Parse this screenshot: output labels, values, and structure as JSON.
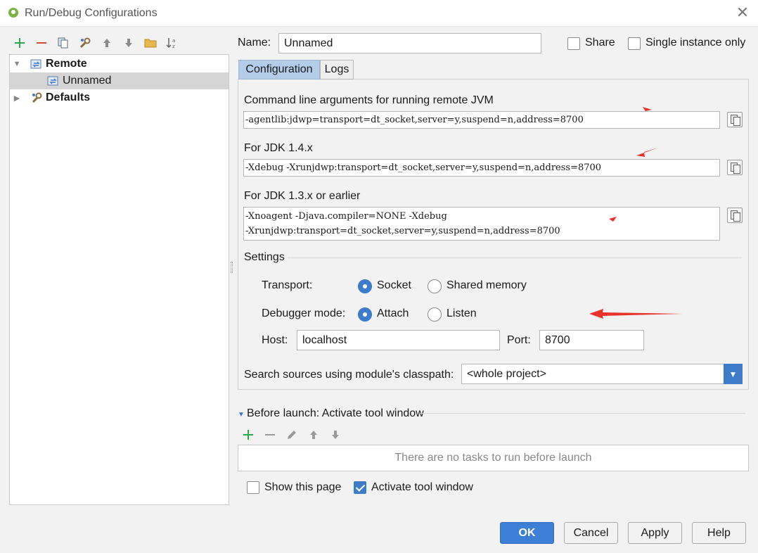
{
  "window": {
    "title": "Run/Debug Configurations"
  },
  "tree": {
    "items": [
      {
        "label": "Remote"
      },
      {
        "label": "Unnamed"
      },
      {
        "label": "Defaults"
      }
    ]
  },
  "form": {
    "name_label": "Name:",
    "name_value": "Unnamed",
    "share_label": "Share",
    "single_instance_label": "Single instance only"
  },
  "tabs": [
    {
      "label": "Configuration"
    },
    {
      "label": "Logs"
    }
  ],
  "config": {
    "jvm_label": "Command line arguments for running remote JVM",
    "jvm_value": "-agentlib:jdwp=transport=dt_socket,server=y,suspend=n,address=8700",
    "jdk14_label": "For JDK 1.4.x",
    "jdk14_value": "-Xdebug -Xrunjdwp:transport=dt_socket,server=y,suspend=n,address=8700",
    "jdk13_label": "For JDK 1.3.x or earlier",
    "jdk13_line1": "-Xnoagent -Djava.compiler=NONE -Xdebug",
    "jdk13_line2": "-Xrunjdwp:transport=dt_socket,server=y,suspend=n,address=8700",
    "settings_label": "Settings",
    "transport_label": "Transport:",
    "transport_socket": "Socket",
    "transport_shared": "Shared memory",
    "debugger_label": "Debugger mode:",
    "debugger_attach": "Attach",
    "debugger_listen": "Listen",
    "host_label": "Host:",
    "host_value": "localhost",
    "port_label": "Port:",
    "port_value": "8700",
    "search_sources_label": "Search sources using module's classpath:",
    "search_sources_value": "<whole project>"
  },
  "before_launch": {
    "title": "Before launch: Activate tool window",
    "empty_text": "There are no tasks to run before launch",
    "show_page_label": "Show this page",
    "activate_tool_label": "Activate tool window"
  },
  "buttons": {
    "ok": "OK",
    "cancel": "Cancel",
    "apply": "Apply",
    "help": "Help"
  },
  "colors": {
    "accent": "#3d7ccb",
    "annotation_arrow": "#e8332b",
    "add_icon": "#2fa84f",
    "remove_icon": "#d9463a"
  }
}
